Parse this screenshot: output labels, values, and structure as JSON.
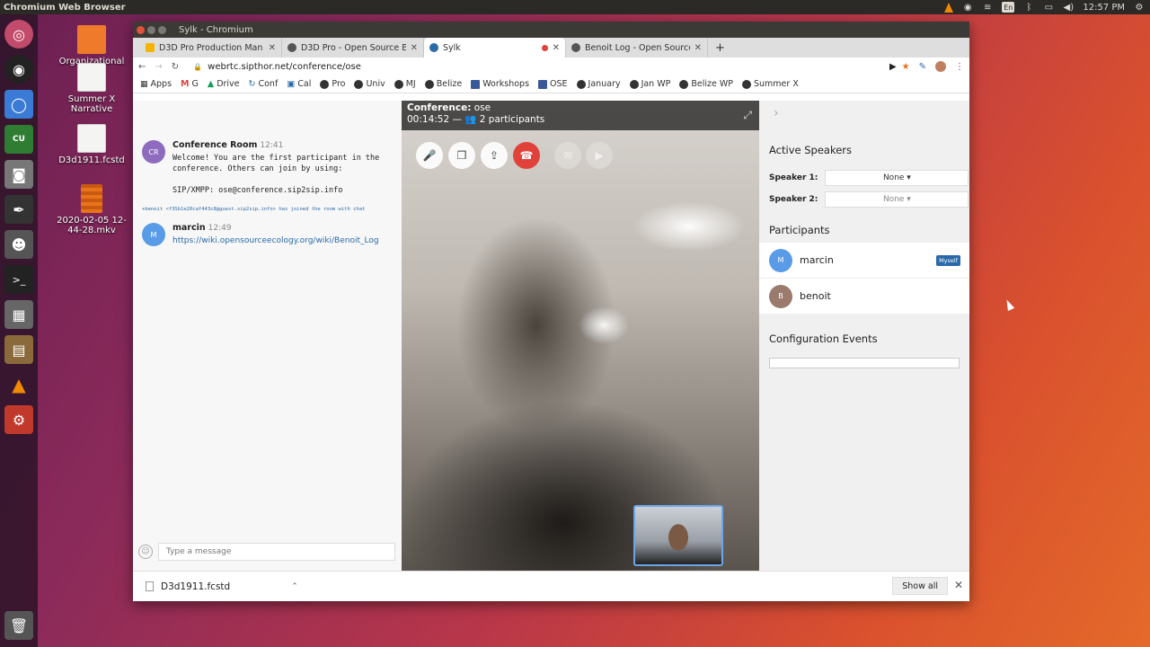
{
  "os": {
    "app_title": "Chromium Web Browser",
    "clock": "12:57 PM",
    "keyboard": "En"
  },
  "desktop": {
    "icons": [
      {
        "label": "Organizational"
      },
      {
        "label": "Summer X Narrative"
      },
      {
        "label": "D3d1911.fcstd"
      },
      {
        "label": "2020-02-05 12-44-28.mkv"
      }
    ]
  },
  "window": {
    "title": "Sylk - Chromium"
  },
  "tabs": [
    {
      "label": "D3D Pro Production Man",
      "favicon_color": "#f4b400"
    },
    {
      "label": "D3D Pro - Open Source E",
      "favicon_color": "#555555"
    },
    {
      "label": "Sylk",
      "favicon_color": "#2a6aa8"
    },
    {
      "label": "Benoit Log - Open Source",
      "favicon_color": "#555555"
    }
  ],
  "address": {
    "url": "webrtc.sipthor.net/conference/ose"
  },
  "bookmarks": [
    {
      "label": "Apps"
    },
    {
      "label": "G"
    },
    {
      "label": "Drive"
    },
    {
      "label": "Conf"
    },
    {
      "label": "Cal"
    },
    {
      "label": "Pro"
    },
    {
      "label": "Univ"
    },
    {
      "label": "MJ"
    },
    {
      "label": "Belize"
    },
    {
      "label": "Workshops"
    },
    {
      "label": "OSE"
    },
    {
      "label": "January"
    },
    {
      "label": "Jan WP"
    },
    {
      "label": "Belize WP"
    },
    {
      "label": "Summer X"
    }
  ],
  "chat": {
    "messages": [
      {
        "avatar": "CR",
        "avatar_color": "#8e6bbf",
        "author": "Conference Room",
        "time": "12:41",
        "text": "Welcome! You are the first participant in the\nconference. Others can join by using:\n\nSIP/XMPP: ose@conference.sip2sip.info"
      },
      {
        "avatar": "M",
        "avatar_color": "#5a9be8",
        "author": "marcin",
        "time": "12:49",
        "link": "https://wiki.opensourceecology.org/wiki/Benoit_Log"
      }
    ],
    "joined_notice": "+benoit <f3Sb1e20caf443c8@guest.sip2sip.info> has joined the room with chat",
    "input_placeholder": "Type a message"
  },
  "conference": {
    "label": "Conference:",
    "room": "ose",
    "duration": "00:14:52",
    "participants_text": "2 participants"
  },
  "side": {
    "active_speakers_title": "Active Speakers",
    "speaker1_label": "Speaker 1:",
    "speaker1_value": "None ▾",
    "speaker2_label": "Speaker 2:",
    "speaker2_value": "None ▾",
    "participants_title": "Participants",
    "participants": [
      {
        "avatar": "M",
        "name": "marcin",
        "badge": "Myself",
        "avatar_color": "#5a9be8"
      },
      {
        "avatar": "B",
        "name": "benoit",
        "avatar_color": "#9a7b6e"
      }
    ],
    "config_title": "Configuration Events"
  },
  "downloads": {
    "file": "D3d1911.fcstd",
    "show_all": "Show all"
  }
}
